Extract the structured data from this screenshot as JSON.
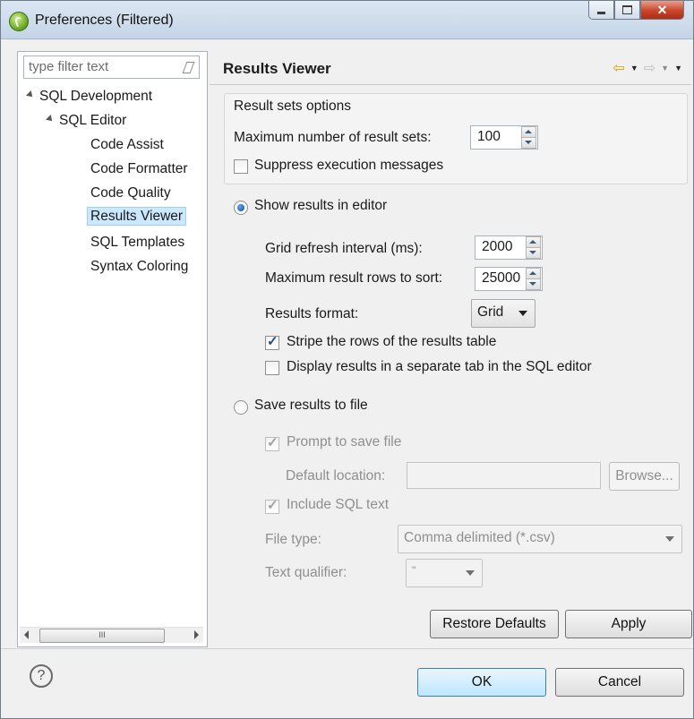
{
  "window": {
    "title": "Preferences (Filtered)"
  },
  "filter": {
    "placeholder": "type filter text"
  },
  "tree": {
    "items": [
      {
        "label": "SQL Development"
      },
      {
        "label": "SQL Editor"
      },
      {
        "label": "Code Assist"
      },
      {
        "label": "Code Formatter"
      },
      {
        "label": "Code Quality"
      },
      {
        "label": "Results Viewer"
      },
      {
        "label": "SQL Templates"
      },
      {
        "label": "Syntax Coloring"
      }
    ],
    "selected": "Results Viewer",
    "scroll_thumb": "III"
  },
  "page": {
    "title": "Results Viewer",
    "result_sets_group": "Result sets options",
    "max_result_sets_label": "Maximum number of result sets:",
    "max_result_sets_value": "100",
    "suppress_label": "Suppress execution messages",
    "suppress_checked": false,
    "show_in_editor_label": "Show results in editor",
    "show_in_editor_selected": true,
    "grid_refresh_label": "Grid refresh interval (ms):",
    "grid_refresh_value": "2000",
    "max_sort_label": "Maximum result rows to sort:",
    "max_sort_value": "25000",
    "results_format_label": "Results format:",
    "results_format_value": "Grid",
    "stripe_label": "Stripe the rows of the results table",
    "stripe_checked": true,
    "separate_tab_label": "Display results in a separate tab in the SQL editor",
    "separate_tab_checked": false,
    "save_to_file_label": "Save results to file",
    "save_to_file_selected": false,
    "prompt_label": "Prompt to save file",
    "prompt_checked": true,
    "default_location_label": "Default location:",
    "default_location_value": "",
    "browse_label": "Browse...",
    "include_sql_label": "Include SQL text",
    "include_sql_checked": true,
    "file_type_label": "File type:",
    "file_type_value": "Comma delimited (*.csv)",
    "text_qualifier_label": "Text qualifier:",
    "text_qualifier_value": "\"",
    "restore_defaults_label": "Restore Defaults",
    "apply_label": "Apply"
  },
  "footer": {
    "help_glyph": "?",
    "ok_label": "OK",
    "cancel_label": "Cancel"
  },
  "icons": {
    "titlebar": "eclipse-icon",
    "nav": [
      "back-arrow-icon",
      "forward-arrow-icon",
      "view-menu-icon"
    ]
  },
  "colors": {
    "selection": "#cce8ff",
    "close_button": "#c7452a",
    "primary_button": "#bee6fd"
  }
}
